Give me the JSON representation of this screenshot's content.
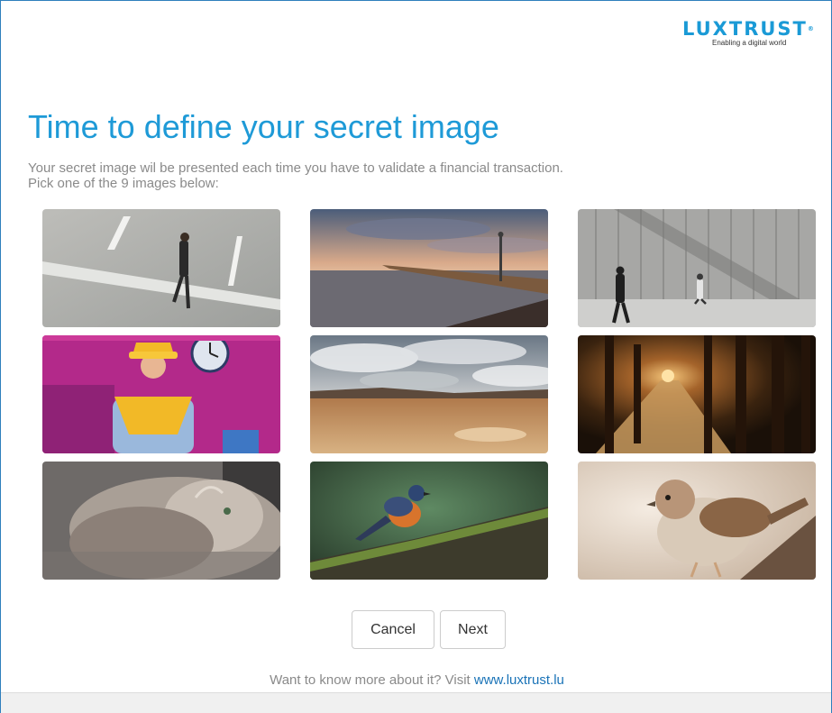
{
  "brand": {
    "name": "LUXTRUST",
    "tagline": "Enabling a digital world",
    "color": "#1a9ad6"
  },
  "heading": {
    "title": "Time to define your secret image",
    "line1": "Your secret image wil be presented each time you have to validate a financial transaction.",
    "line2": "Pick one of the 9 images below:"
  },
  "images": [
    "man-walking-on-road",
    "pier-at-sunset",
    "people-walking-by-wall",
    "costumed-person-on-stage",
    "cloudy-desert-landscape",
    "glowing-forest-path",
    "fluffy-cat",
    "robin-on-mossy-branch",
    "sparrow-bird"
  ],
  "actions": {
    "cancel": "Cancel",
    "next": "Next"
  },
  "footer": {
    "text": "Want to know more about it? Visit ",
    "link_text": "www.luxtrust.lu"
  },
  "colors": {
    "title": "#1e9ad7",
    "frame_border": "#2f7fbd",
    "link": "#1a73b7"
  }
}
